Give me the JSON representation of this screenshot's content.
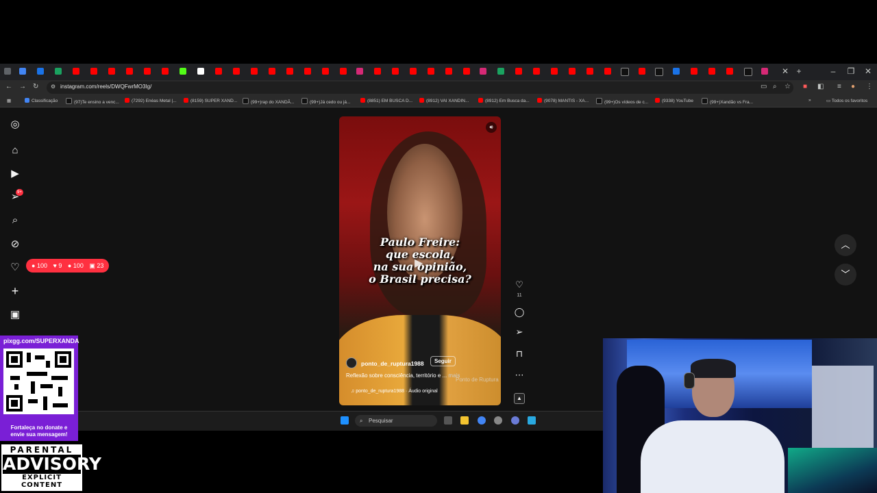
{
  "browser": {
    "url": "instagram.com/reels/DWQFwrMO3Ig/",
    "bookmarks": [
      {
        "label": "Classificação",
        "color": "#4285f4"
      },
      {
        "label": "(97)Te ensino a venc...",
        "color": "#111111"
      },
      {
        "label": "(7292) Enéas Metal |...",
        "color": "#ff0000"
      },
      {
        "label": "(8159) SUPER XAND...",
        "color": "#ff0000"
      },
      {
        "label": "(99+)rap do XANDÃ...",
        "color": "#111111"
      },
      {
        "label": "(99+)Já cedo ou já...",
        "color": "#111111"
      },
      {
        "label": "(8851) EM BUSCA D...",
        "color": "#ff0000"
      },
      {
        "label": "(8912) VAI XANDIN...",
        "color": "#ff0000"
      },
      {
        "label": "(8912) Em Busca da...",
        "color": "#ff0000"
      },
      {
        "label": "(9078) MANTIS - XA...",
        "color": "#ff0000"
      },
      {
        "label": "(99+)Os vídeos de c...",
        "color": "#111111"
      },
      {
        "label": "(9338) YouTube",
        "color": "#ff0000"
      },
      {
        "label": "(99+)Xandão vs Fra...",
        "color": "#111111"
      }
    ],
    "all_bookmarks": "Todos os favoritos"
  },
  "sidebar": {
    "icons": [
      "instagram-icon",
      "home-icon",
      "reels-icon",
      "messages-icon",
      "search-icon",
      "explore-icon",
      "notifications-icon",
      "create-icon",
      "dashboard-icon"
    ],
    "message_badge": "9+"
  },
  "notifications": {
    "comments": "100",
    "likes": "9",
    "followers": "100",
    "tags": "23"
  },
  "reel": {
    "title_lines": [
      "Paulo Freire:",
      "que escola,",
      "na sua opinião,",
      "o Brasil precisa?"
    ],
    "author": "ponto_de_ruptura1988",
    "follow_label": "Seguir",
    "caption": "Reflexão sobre consciência, território e ...",
    "more": "mais",
    "audio": "ponto_de_ruptura1988 · Áudio original",
    "watermark": "Ponto de Ruptura",
    "like_count": "11"
  },
  "taskbar": {
    "search_placeholder": "Pesquisar"
  },
  "donate": {
    "header": "pixgg.com/SUPERXANDA",
    "footer_line1": "Fortaleça no donate e",
    "footer_line2": "envie sua mensagem!"
  },
  "advisory": {
    "line1": "PARENTAL",
    "line2": "ADVISORY",
    "line3": "EXPLICIT CONTENT"
  }
}
